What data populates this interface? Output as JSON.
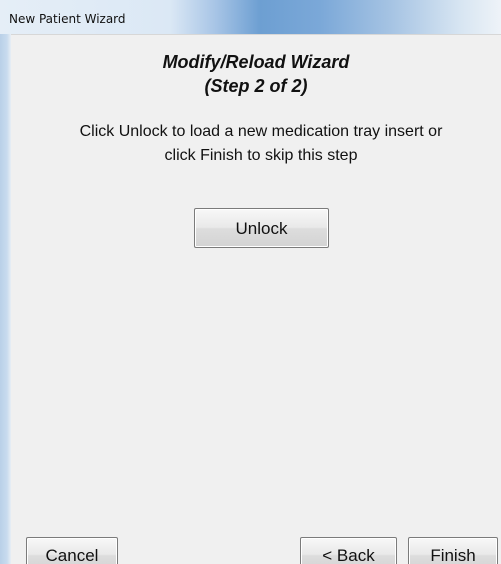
{
  "window": {
    "title": "New Patient Wizard"
  },
  "wizard": {
    "heading_line_1": "Modify/Reload Wizard",
    "heading_line_2": "(Step 2 of 2)",
    "instruction_line_1": "Click Unlock to load a new medication tray insert or",
    "instruction_line_2": "click Finish to skip this step"
  },
  "buttons": {
    "unlock": "Unlock",
    "cancel": "Cancel",
    "back": "< Back",
    "finish": "Finish"
  },
  "colors": {
    "dialog_background": "#f0f0f0",
    "titlebar_accent": "#6d9fd2",
    "button_border": "#7b7b7b"
  }
}
